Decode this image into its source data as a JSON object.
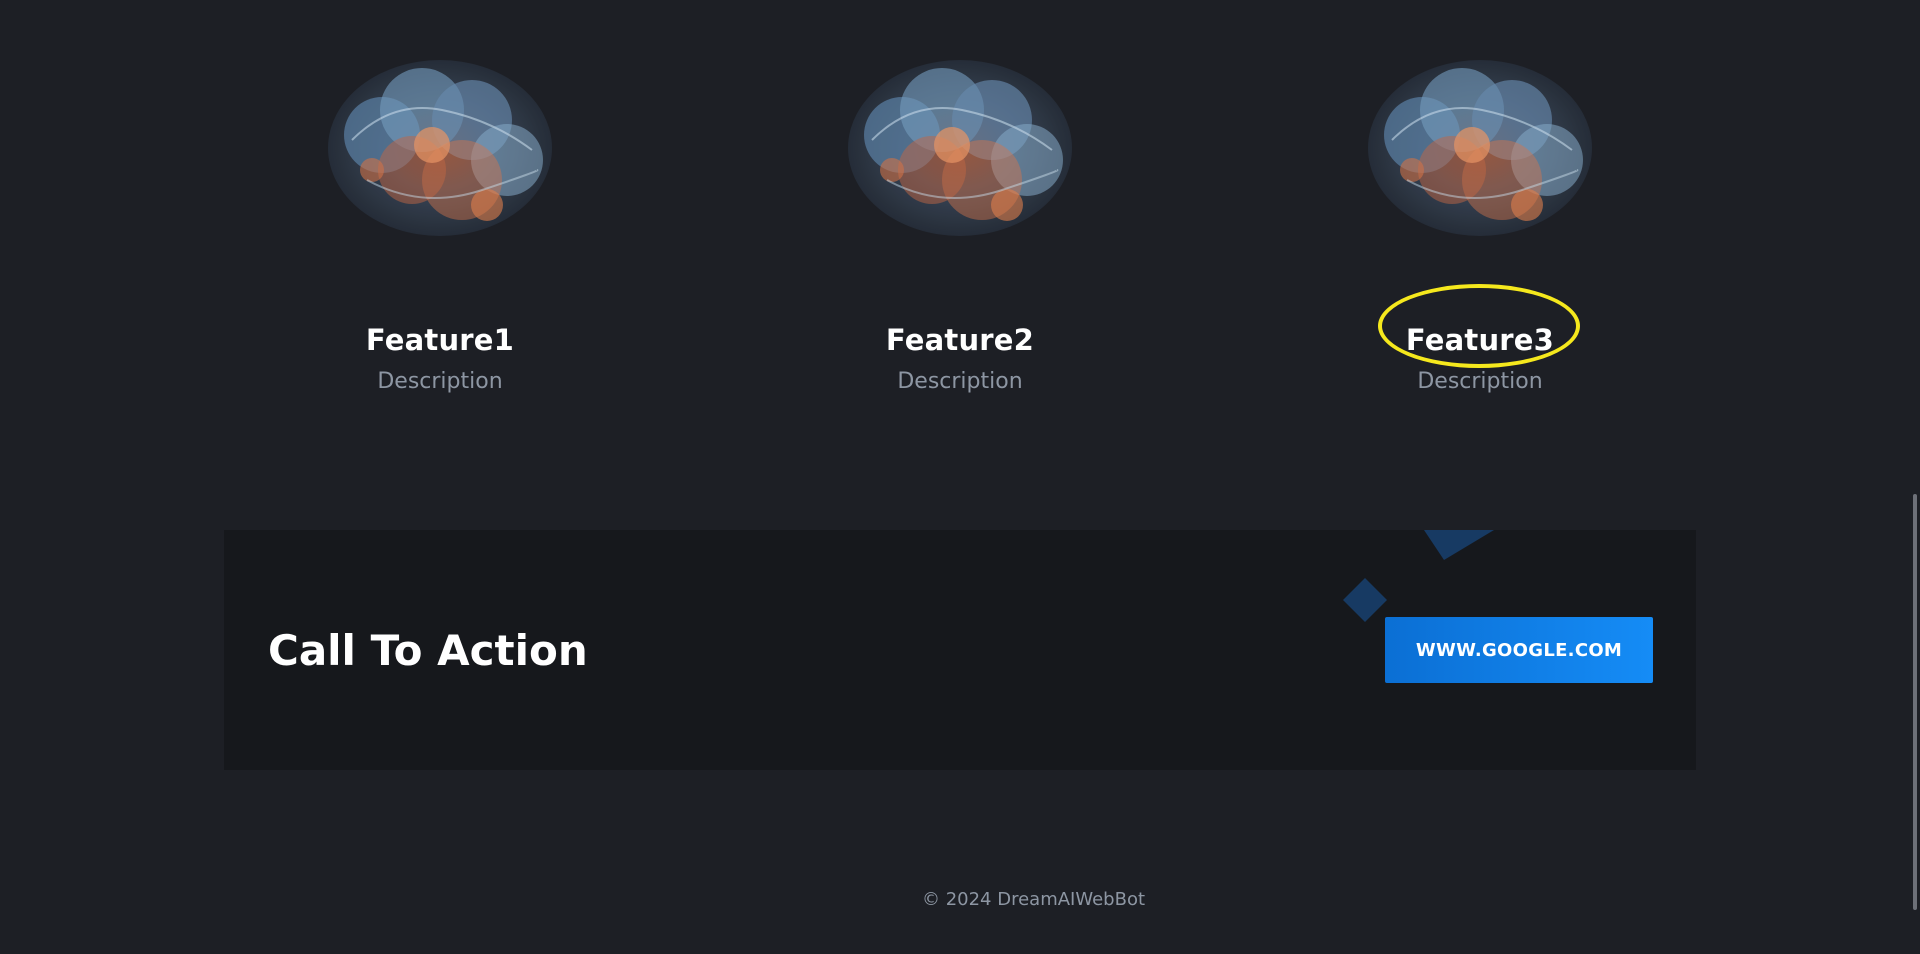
{
  "features": [
    {
      "title": "Feature1",
      "description": "Description",
      "image_icon": "brain-illustration-icon"
    },
    {
      "title": "Feature2",
      "description": "Description",
      "image_icon": "brain-illustration-icon"
    },
    {
      "title": "Feature3",
      "description": "Description",
      "image_icon": "brain-illustration-icon"
    }
  ],
  "cta": {
    "title": "Call To Action",
    "button_label": "WWW.GOOGLE.COM"
  },
  "footer": {
    "copyright": "© 2024 DreamAIWebBot"
  },
  "colors": {
    "background": "#1d1f25",
    "cta_background": "#16181c",
    "accent_blue": "#158cf6",
    "highlight": "#f5e81d",
    "muted_text": "#8d96a3"
  }
}
